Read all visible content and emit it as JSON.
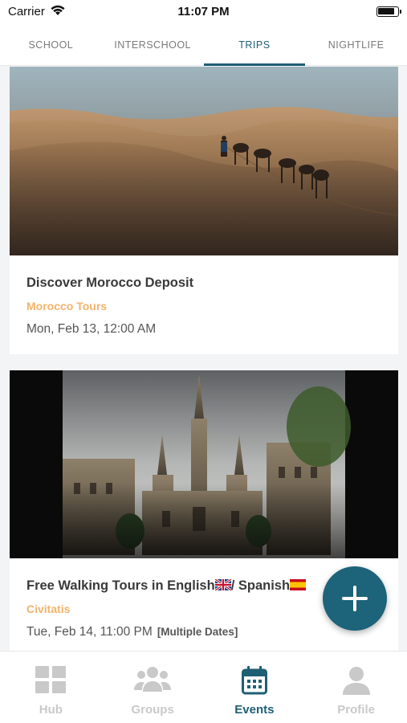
{
  "status": {
    "carrier": "Carrier",
    "time": "11:07 PM"
  },
  "tabs": [
    {
      "label": "SCHOOL"
    },
    {
      "label": "INTERSCHOOL"
    },
    {
      "label": "TRIPS"
    },
    {
      "label": "NIGHTLIFE"
    }
  ],
  "active_tab": "TRIPS",
  "cards": [
    {
      "title": "Discover Morocco Deposit",
      "organizer": "Morocco Tours",
      "date": "Mon, Feb 13, 12:00 AM",
      "image": "desert-camel-caravan"
    },
    {
      "title": "Free Walking Tours in English",
      "title_sep": "/ Spanish",
      "organizer": "Civitatis",
      "date": "Tue, Feb 14, 11:00 PM",
      "extra": "[Multiple Dates]",
      "image": "gothic-cathedral"
    }
  ],
  "fab": {
    "icon": "plus-icon"
  },
  "bottom_nav": [
    {
      "label": "Hub",
      "icon": "grid-icon"
    },
    {
      "label": "Groups",
      "icon": "people-icon"
    },
    {
      "label": "Events",
      "icon": "calendar-icon"
    },
    {
      "label": "Profile",
      "icon": "person-icon"
    }
  ],
  "active_nav": "Events",
  "colors": {
    "accent": "#1e5f74",
    "organizer": "#f3b36a",
    "inactive": "#c9c9c9"
  }
}
